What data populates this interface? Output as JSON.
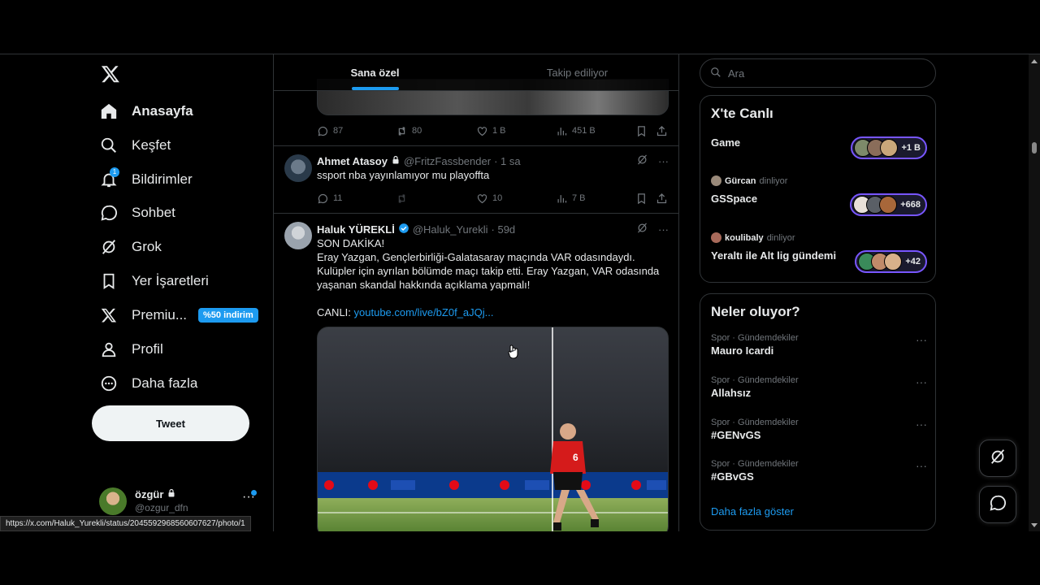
{
  "nav": {
    "items": [
      {
        "label": "Anasayfa",
        "icon": "home-icon"
      },
      {
        "label": "Keşfet",
        "icon": "search-icon"
      },
      {
        "label": "Bildirimler",
        "icon": "bell-icon",
        "badge": "1"
      },
      {
        "label": "Sohbet",
        "icon": "chat-icon"
      },
      {
        "label": "Grok",
        "icon": "grok-icon"
      },
      {
        "label": "Yer İşaretleri",
        "icon": "bookmark-icon"
      },
      {
        "label": "Premiu...",
        "icon": "x-logo-icon",
        "promo": "%50 indirim"
      },
      {
        "label": "Profil",
        "icon": "person-icon"
      },
      {
        "label": "Daha fazla",
        "icon": "more-circle-icon"
      }
    ],
    "tweet_button": "Tweet",
    "account": {
      "name": "özgür",
      "handle": "@ozgur_dfn"
    }
  },
  "tabs": [
    {
      "label": "Sana özel",
      "active": true
    },
    {
      "label": "Takip ediliyor",
      "active": false
    }
  ],
  "posts": [
    {
      "replies": "87",
      "reposts": "80",
      "likes": "1 B",
      "views": "451 B"
    },
    {
      "name": "Ahmet Atasoy",
      "handle": "@FritzFassbender",
      "time": "· 1 sa",
      "text": "ssport nba yayınlamıyor mu playoffta",
      "replies": "11",
      "reposts": "",
      "likes": "10",
      "views": "7 B"
    },
    {
      "name": "Haluk YÜREKLİ",
      "handle": "@Haluk_Yurekli",
      "time": "· 59d",
      "line1": "SON DAKİKA!",
      "line2": "Eray Yazgan, Gençlerbirliği-Galatasaray maçında VAR odasındaydı. Kulüpler için ayrılan bölümde maçı takip etti. Eray Yazgan, VAR odasında yaşanan skandal hakkında açıklama yapmalı!",
      "line3_prefix": "CANLI: ",
      "link": "youtube.com/live/bZ0f_aJQj...",
      "jersey_number": "6"
    }
  ],
  "search": {
    "placeholder": "Ara"
  },
  "live": {
    "title": "X'te Canlı",
    "spaces": [
      {
        "title": "Game",
        "count": "+1 B"
      },
      {
        "host": "Gürcan",
        "host_suffix": "dinliyor",
        "title": "GSSpace",
        "count": "+668"
      },
      {
        "host": "koulibaly",
        "host_suffix": "dinliyor",
        "title": "Yeraltı ile Alt lig gündemi",
        "count": "+42"
      }
    ]
  },
  "trends": {
    "title": "Neler oluyor?",
    "items": [
      {
        "meta": "Spor · Gündemdekiler",
        "name": "Mauro Icardi"
      },
      {
        "meta": "Spor · Gündemdekiler",
        "name": "Allahsız"
      },
      {
        "meta": "Spor · Gündemdekiler",
        "name": "#GENvGS"
      },
      {
        "meta": "Spor · Gündemdekiler",
        "name": "#GBvGS"
      }
    ],
    "show_more": "Daha fazla göster"
  },
  "status_url": "https://x.com/Haluk_Yurekli/status/2045592968560607627/photo/1",
  "colors": {
    "accent": "#1d9bf0",
    "background": "#000000",
    "border": "#2f3336",
    "muted": "#71767b",
    "live_ring": "#7856ff"
  }
}
